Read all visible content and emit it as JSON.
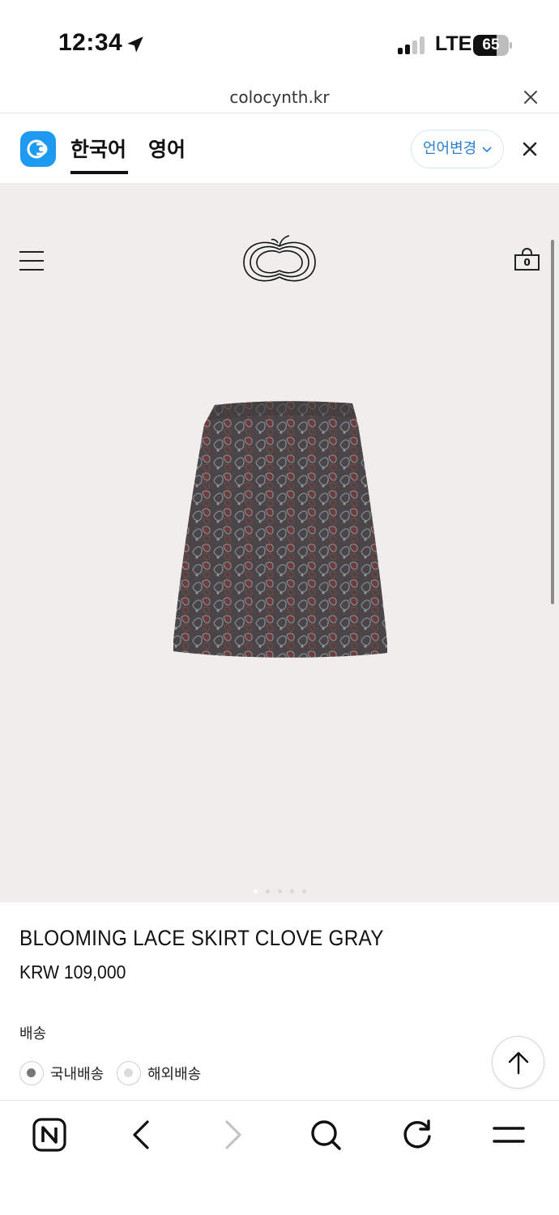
{
  "status_bar": {
    "time": "12:34",
    "network": "LTE",
    "battery": "65",
    "battery_level": 0.65
  },
  "browser": {
    "url": "colocynth.kr"
  },
  "translate_bar": {
    "tabs": [
      "한국어",
      "영어"
    ],
    "active_tab": 0,
    "change_button": "언어변경"
  },
  "header": {
    "cart_count": "0"
  },
  "gallery": {
    "slide_count": 5,
    "active_slide": 0
  },
  "product": {
    "name": "BLOOMING LACE SKIRT CLOVE GRAY",
    "price": "KRW 109,000",
    "shipping": {
      "label": "배송",
      "options": [
        "국내배송",
        "해외배송"
      ],
      "selected": 0
    }
  },
  "toolbar": {
    "icons": [
      "naver-home-icon",
      "back-icon",
      "forward-icon",
      "search-icon",
      "reload-icon",
      "menu-icon"
    ]
  },
  "colors": {
    "accent_blue": "#1e9bf0",
    "link_blue": "#2b7fd0",
    "product_bg": "#efeeec",
    "skirt": "#4a4446"
  }
}
